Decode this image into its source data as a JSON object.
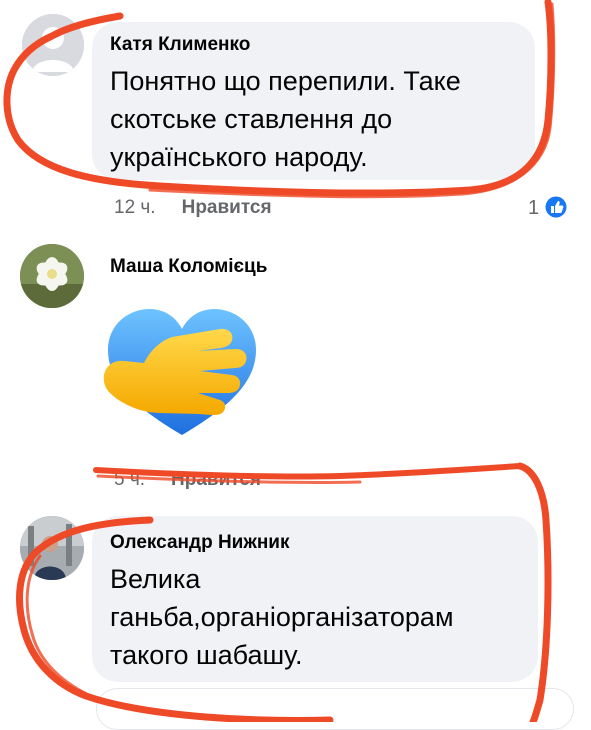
{
  "comments": [
    {
      "author": "Катя Клименко",
      "text_lines": [
        "Понятно що перепили. Таке",
        "скотське ставлення до",
        "українського народу."
      ],
      "time": "12 ч.",
      "like_label": "Нравится",
      "reaction_count": "1"
    },
    {
      "author": "Маша Коломієць",
      "sticker": "heart-hand-sticker",
      "time": "5 ч.",
      "like_label": "Нравится"
    },
    {
      "author": "Олександр Нижник",
      "text_lines": [
        "Велика",
        "ганьба,органіорганізаторам",
        "такого шабашу."
      ]
    }
  ],
  "colors": {
    "bubble": "#f0f2f5",
    "meta_text": "#65676b",
    "like_blue": "#1877f2",
    "scribble_red": "#ef4a28"
  }
}
